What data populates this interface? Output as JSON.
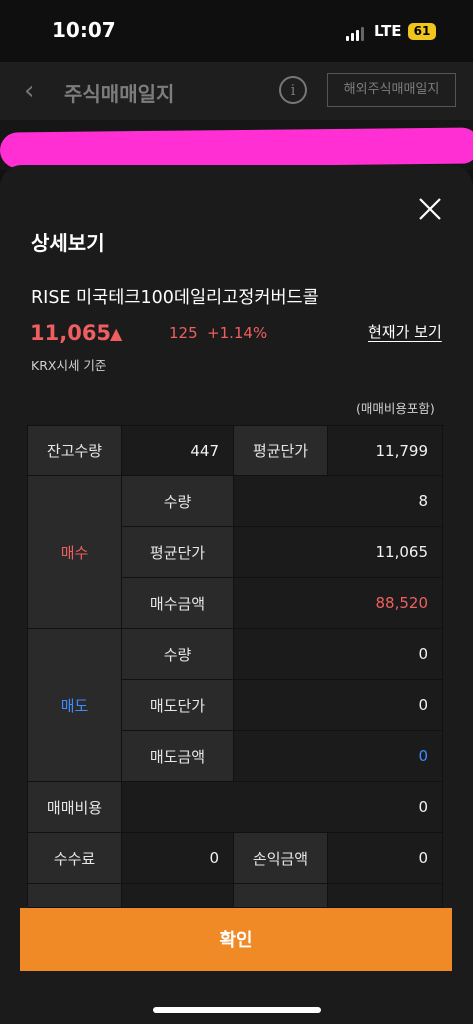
{
  "status": {
    "time": "10:07",
    "network": "LTE",
    "battery": "61"
  },
  "header": {
    "title": "주식매매일지",
    "overseas_button": "해외주식매매일지",
    "info_glyph": "i"
  },
  "sheet": {
    "title": "상세보기",
    "stock_name": "RISE 미국테크100데일리고정커버드콜",
    "price": "11,065",
    "arrow": "▲",
    "change": "125",
    "change_pct": "+1.14%",
    "current_price_link": "현재가 보기",
    "price_basis": "KRX시세 기준",
    "fee_note": "(매매비용포함)"
  },
  "table": {
    "balance_qty_label": "잔고수량",
    "balance_qty": "447",
    "avg_price_label": "평균단가",
    "avg_price": "11,799",
    "buy_label": "매수",
    "buy_qty_label": "수량",
    "buy_qty": "8",
    "buy_avg_label": "평균단가",
    "buy_avg": "11,065",
    "buy_amount_label": "매수금액",
    "buy_amount": "88,520",
    "sell_label": "매도",
    "sell_qty_label": "수량",
    "sell_qty": "0",
    "sell_price_label": "매도단가",
    "sell_price": "0",
    "sell_amount_label": "매도금액",
    "sell_amount": "0",
    "trade_cost_label": "매매비용",
    "trade_cost": "0",
    "commission_label": "수수료",
    "commission": "0",
    "pnl_label": "손익금액",
    "pnl": "0"
  },
  "confirm_button": "확인",
  "colors": {
    "up": "#ef5f5f",
    "down": "#3d8bff",
    "accent": "#f08a26",
    "redaction": "#ff2fd3"
  }
}
